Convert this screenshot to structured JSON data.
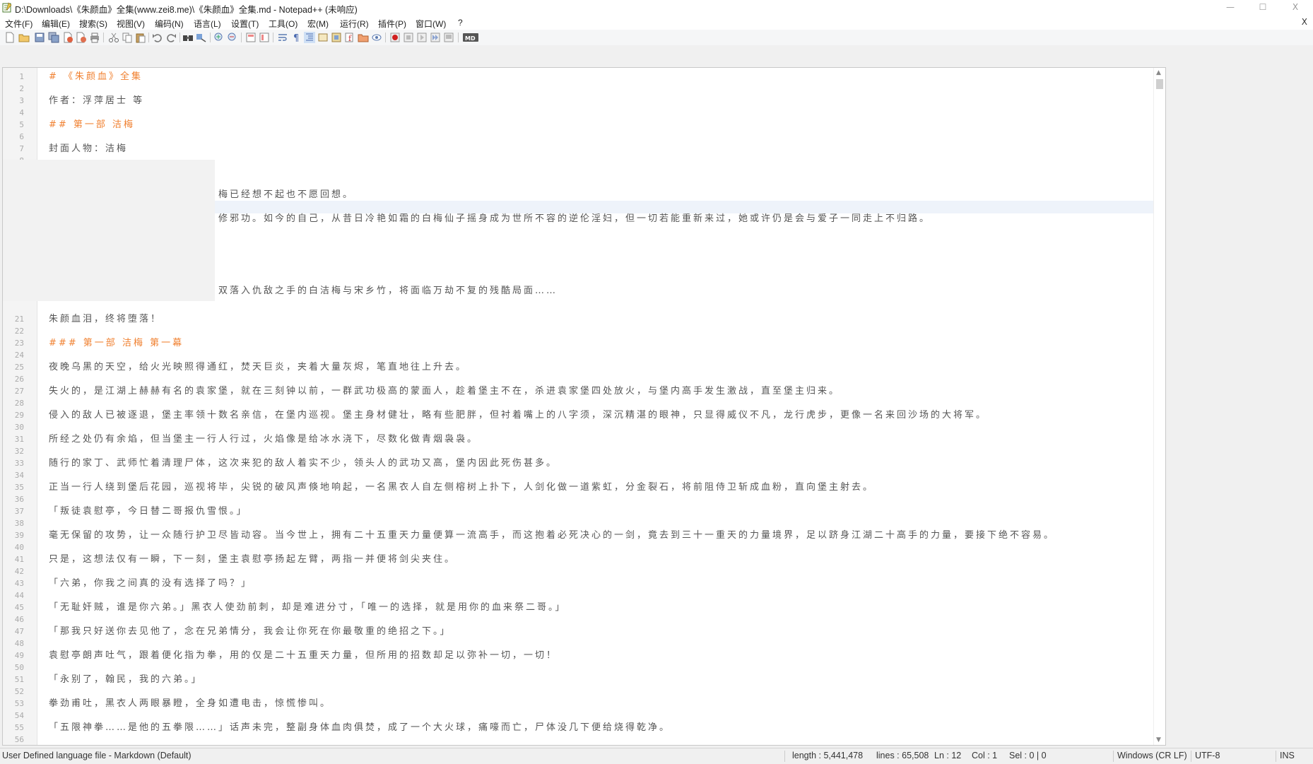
{
  "window": {
    "title": "D:\\Downloads\\《朱颜血》全集(www.zei8.me)\\《朱颜血》全集.md - Notepad++ (未响应)",
    "close_glyph": "X"
  },
  "menu": [
    "文件(F)",
    "编辑(E)",
    "搜索(S)",
    "视图(V)",
    "编码(N)",
    "语言(L)",
    "设置(T)",
    "工具(O)",
    "宏(M)",
    "运行(R)",
    "插件(P)",
    "窗口(W)",
    "?"
  ],
  "menu_close": "X",
  "toolbar_icons": [
    "new-file-icon",
    "open-file-icon",
    "save-icon",
    "save-all-icon",
    "close-icon",
    "close-all-icon",
    "print-icon",
    "cut-icon",
    "copy-icon",
    "paste-icon",
    "undo-icon",
    "redo-icon",
    "find-icon",
    "replace-icon",
    "zoom-in-icon",
    "zoom-out-icon",
    "sync-vertical-icon",
    "sync-horizontal-icon",
    "word-wrap-icon",
    "show-all-chars-icon",
    "indent-guide-icon",
    "udl-icon",
    "doc-map-icon",
    "function-list-icon",
    "folder-workspace-icon",
    "monitoring-icon",
    "record-macro-icon",
    "stop-macro-icon",
    "play-macro-icon",
    "run-macro-multiple-icon",
    "save-macro-icon",
    "markdown-icon"
  ],
  "editor": {
    "heading_color": "#f08030",
    "text_color": "#555555",
    "lines": [
      {
        "n": "1",
        "text": "# 《朱颜血》全集",
        "h": true
      },
      {
        "n": "2",
        "text": ""
      },
      {
        "n": "3",
        "text": "作者：浮萍居士 等"
      },
      {
        "n": "4",
        "text": ""
      },
      {
        "n": "5",
        "text": "## 第一部 洁梅",
        "h": true
      },
      {
        "n": "6",
        "text": ""
      },
      {
        "n": "7",
        "text": "封面人物：洁梅"
      },
      {
        "n": "8",
        "text": ""
      },
      {
        "n": "21",
        "text": "朱颜血泪，终将堕落！"
      },
      {
        "n": "22",
        "text": ""
      },
      {
        "n": "23",
        "text": "### 第一部 洁梅 第一幕",
        "h": true
      },
      {
        "n": "24",
        "text": ""
      },
      {
        "n": "25",
        "text": "夜晚乌黑的天空，给火光映照得通红，焚天巨炎，夹着大量灰烬，笔直地往上升去。"
      },
      {
        "n": "26",
        "text": ""
      },
      {
        "n": "27",
        "text": "失火的，是江湖上赫赫有名的袁家堡，就在三刻钟以前，一群武功极高的蒙面人，趁着堡主不在，杀进袁家堡四处放火，与堡内高手发生激战，直至堡主归来。"
      },
      {
        "n": "28",
        "text": ""
      },
      {
        "n": "29",
        "text": "侵入的敌人已被逐退，堡主率领十数名亲信，在堡内巡视。堡主身材健壮，略有些肥胖，但衬着嘴上的八字须，深沉精湛的眼神，只显得威仪不凡，龙行虎步，更像一名来回沙场的大将军。"
      },
      {
        "n": "30",
        "text": ""
      },
      {
        "n": "31",
        "text": "所经之处仍有余焰，但当堡主一行人行过，火焰像是给冰水浇下，尽数化做青烟袅袅。"
      },
      {
        "n": "32",
        "text": ""
      },
      {
        "n": "33",
        "text": "随行的家丁、武师忙着清理尸体，这次来犯的敌人着实不少，领头人的武功又高，堡内因此死伤甚多。"
      },
      {
        "n": "34",
        "text": ""
      },
      {
        "n": "35",
        "text": "正当一行人绕到堡后花园，巡视将毕，尖锐的破风声倏地响起，一名黑衣人自左侧榕树上扑下，人剑化做一道紫虹，分金裂石，将前阻侍卫斩成血粉，直向堡主射去。"
      },
      {
        "n": "36",
        "text": ""
      },
      {
        "n": "37",
        "text": "「叛徒袁慰亭，今日替二哥报仇雪恨。」"
      },
      {
        "n": "38",
        "text": ""
      },
      {
        "n": "39",
        "text": "毫无保留的攻势，让一众随行护卫尽皆动容。当今世上，拥有二十五重天力量便算一流高手，而这抱着必死决心的一剑，竟去到三十一重天的力量境界，足以跻身江湖二十高手的力量，要接下绝不容易。"
      },
      {
        "n": "40",
        "text": ""
      },
      {
        "n": "41",
        "text": "只是，这想法仅有一瞬，下一刻，堡主袁慰亭扬起左臂，两指一并便将剑尖夹住。"
      },
      {
        "n": "42",
        "text": ""
      },
      {
        "n": "43",
        "text": "「六弟，你我之间真的没有选择了吗？」"
      },
      {
        "n": "44",
        "text": ""
      },
      {
        "n": "45",
        "text": "「无耻奸贼，谁是你六弟。」黑衣人使劲前刺，却是难进分寸，「唯一的选择，就是用你的血来祭二哥。」"
      },
      {
        "n": "46",
        "text": ""
      },
      {
        "n": "47",
        "text": "「那我只好送你去见他了，念在兄弟情分，我会让你死在你最敬重的绝招之下。」"
      },
      {
        "n": "48",
        "text": ""
      },
      {
        "n": "49",
        "text": "袁慰亭朗声吐气，跟着便化指为拳，用的仅是二十五重天力量，但所用的招数却足以弥补一切，一切！"
      },
      {
        "n": "50",
        "text": ""
      },
      {
        "n": "51",
        "text": "「永别了，翰民，我的六弟。」"
      },
      {
        "n": "52",
        "text": ""
      },
      {
        "n": "53",
        "text": "拳劲甫吐，黑衣人两眼暴瞪，全身如遭电击，惊慌惨叫。"
      },
      {
        "n": "54",
        "text": ""
      },
      {
        "n": "55",
        "text": "「五限神拳……是他的五拳限……」话声未完，整副身体血肉俱焚，成了一个大火球，痛嚎而亡，尸体没几下便给烧得乾净。"
      },
      {
        "n": "56",
        "text": ""
      }
    ],
    "fragments": [
      {
        "text": "梅已经想不起也不愿回想。"
      },
      {
        "text": "修邪功。如今的自己，从昔日冷艳如霜的白梅仙子摇身成为世所不容的逆伦淫妇，但一切若能重新来过，她或许仍是会与爱子一同走上不归路。"
      },
      {
        "text": "双落入仇敌之手的白洁梅与宋乡竹，将面临万劫不复的残酷局面……"
      }
    ]
  },
  "status": {
    "language": "User Defined language file - Markdown (Default)",
    "length": "length : 5,441,478",
    "lines": "lines : 65,508",
    "ln": "Ln : 12",
    "col": "Col : 1",
    "sel": "Sel : 0 | 0",
    "eol": "Windows (CR LF)",
    "encoding": "UTF-8",
    "mode": "INS"
  }
}
